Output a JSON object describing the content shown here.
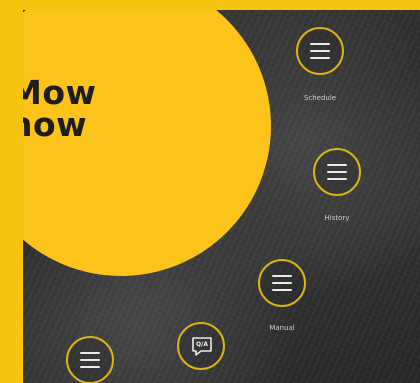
{
  "mow": {
    "label": "Mow\nnow"
  },
  "menu": {
    "schedule": {
      "label": "Schedule",
      "icon": "hamburger-icon"
    },
    "history": {
      "label": "History",
      "icon": "hamburger-icon"
    },
    "manual": {
      "label": "Manual",
      "icon": "hamburger-icon"
    },
    "more": {
      "label": "",
      "icon": "hamburger-icon"
    },
    "qa": {
      "label": "Q/A",
      "icon": "chat-bubble-icon"
    }
  },
  "colors": {
    "accent": "#fcc31a",
    "ring": "#d9b414",
    "background": "#2e2e2e",
    "frame": "#f6c40f"
  }
}
